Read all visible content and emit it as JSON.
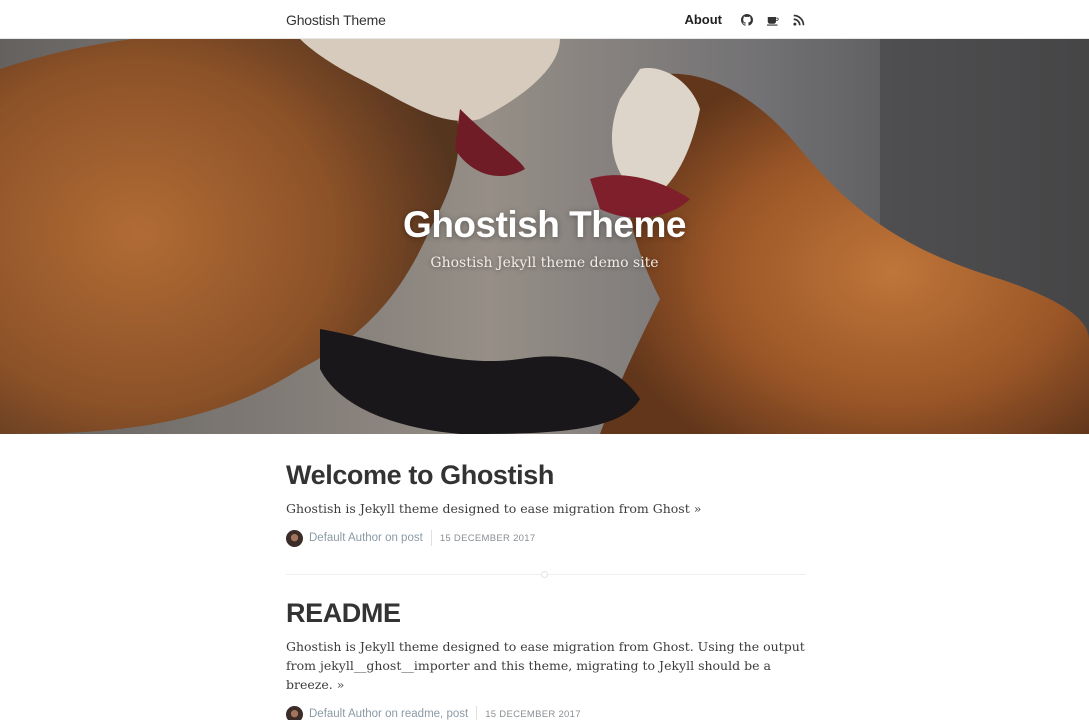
{
  "nav": {
    "brand": "Ghostish Theme",
    "about": "About",
    "icons": [
      "github-icon",
      "coffee-icon",
      "rss-icon"
    ]
  },
  "hero": {
    "title": "Ghostish Theme",
    "subtitle": "Ghostish Jekyll theme demo site"
  },
  "posts": [
    {
      "title": "Welcome to Ghostish",
      "excerpt": "Ghostish is Jekyll theme designed to ease migration from Ghost »",
      "author_line": "Default Author on post",
      "date": "15 December 2017"
    },
    {
      "title": "README",
      "excerpt": "Ghostish is Jekyll theme designed to ease migration from Ghost. Using the output from jekyll__ghost__importer and this theme, migrating to Jekyll should be a breeze. »",
      "author_line": "Default Author on readme, post",
      "date": "15 December 2017"
    }
  ],
  "colors": {
    "text": "#333333",
    "meta": "#8a9aa5",
    "divider": "#efefef"
  }
}
